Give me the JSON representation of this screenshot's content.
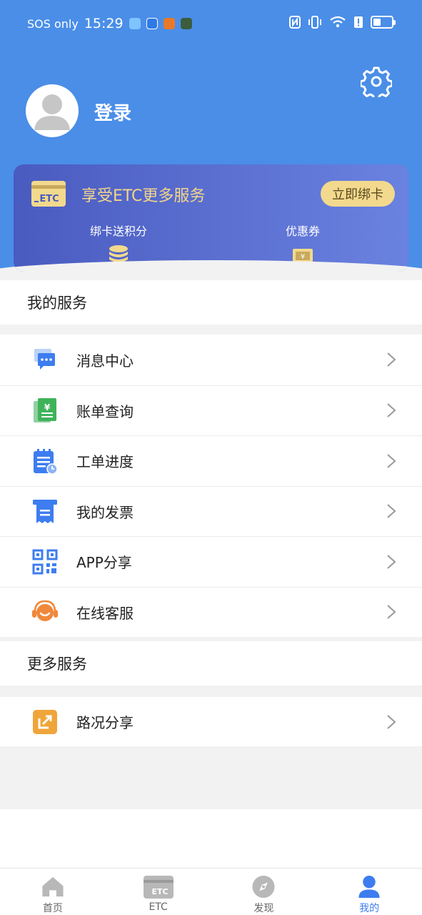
{
  "status_bar": {
    "carrier": "SOS only",
    "time": "15:29",
    "battery_level": 0.4
  },
  "profile": {
    "login_label": "登录"
  },
  "etc_card": {
    "logo_text": "ETC",
    "promo_text": "享受ETC更多服务",
    "bind_button": "立即绑卡",
    "features": [
      {
        "label": "绑卡送积分",
        "icon": "coins-icon"
      },
      {
        "label": "优惠券",
        "icon": "coupon-icon"
      }
    ]
  },
  "my_services": {
    "title": "我的服务",
    "items": [
      {
        "label": "消息中心",
        "icon": "message-icon"
      },
      {
        "label": "账单查询",
        "icon": "bill-icon"
      },
      {
        "label": "工单进度",
        "icon": "work-order-icon"
      },
      {
        "label": "我的发票",
        "icon": "invoice-icon"
      },
      {
        "label": "APP分享",
        "icon": "qr-code-icon"
      },
      {
        "label": "在线客服",
        "icon": "customer-service-icon"
      }
    ]
  },
  "more_services": {
    "title": "更多服务",
    "items": [
      {
        "label": "路况分享",
        "icon": "share-icon"
      }
    ]
  },
  "bottom_nav": {
    "items": [
      {
        "label": "首页",
        "icon": "home-icon"
      },
      {
        "label": "ETC",
        "icon": "etc-card-icon"
      },
      {
        "label": "发现",
        "icon": "compass-icon"
      },
      {
        "label": "我的",
        "icon": "user-icon",
        "active": true
      }
    ]
  },
  "colors": {
    "primary": "#4a8ee8",
    "accent_gold": "#f2d98d",
    "nav_active": "#3d7df0"
  }
}
